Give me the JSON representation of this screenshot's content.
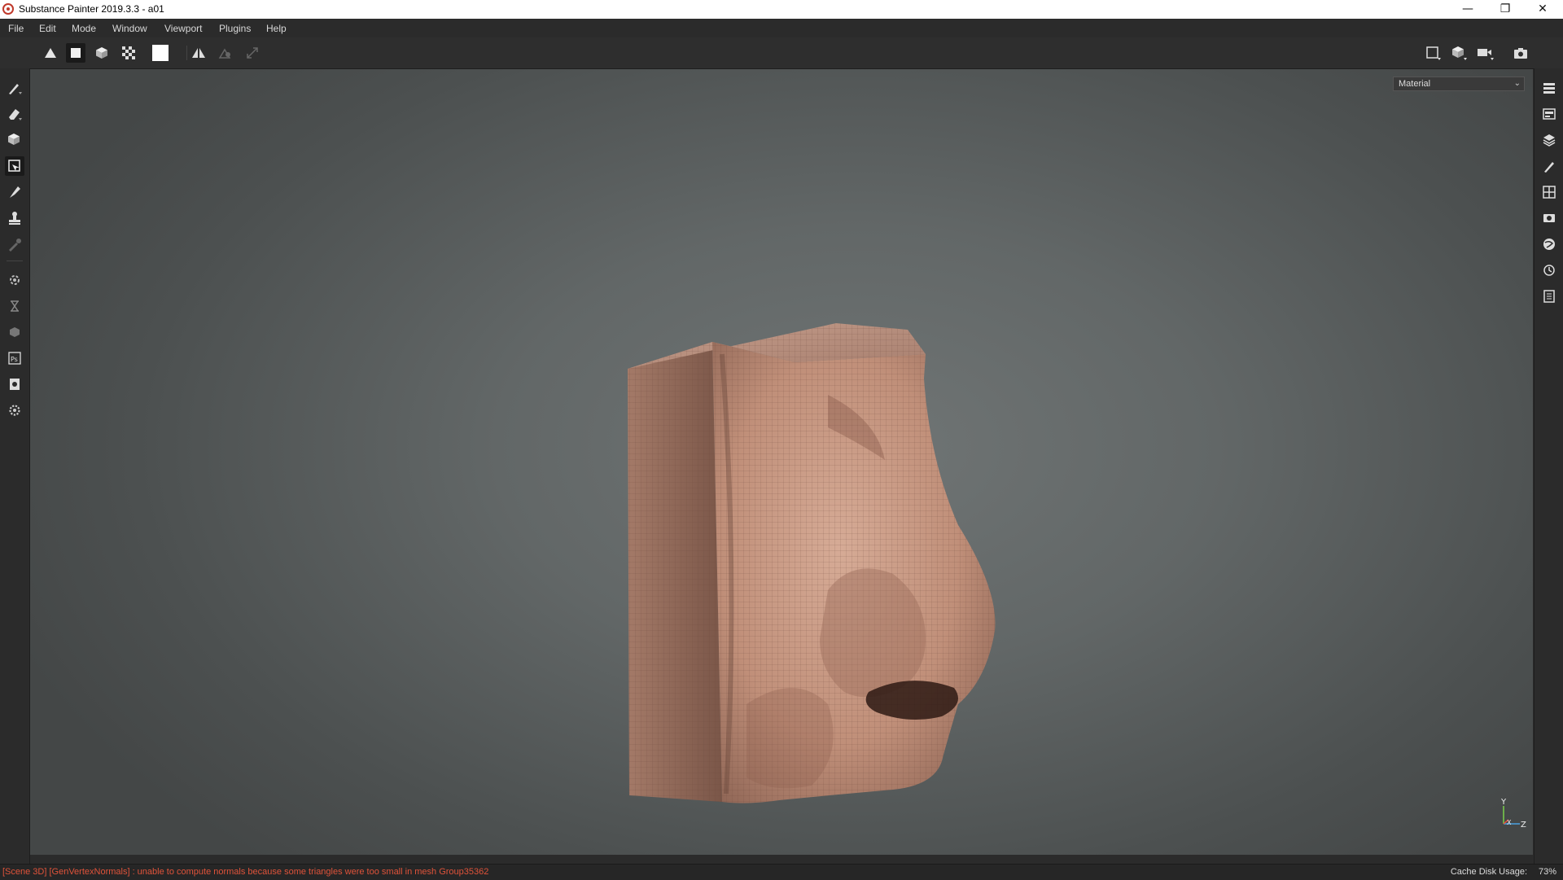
{
  "window": {
    "title": "Substance Painter 2019.3.3 - a01",
    "controls": [
      "minimize",
      "restore",
      "close"
    ]
  },
  "menu": {
    "items": [
      {
        "label": "File"
      },
      {
        "label": "Edit"
      },
      {
        "label": "Mode"
      },
      {
        "label": "Window"
      },
      {
        "label": "Viewport"
      },
      {
        "label": "Plugins"
      },
      {
        "label": "Help"
      }
    ]
  },
  "toolbar": {
    "left_icons": [
      "triangle-mode-icon",
      "square-mode-icon",
      "cube-mode-icon",
      "checker-mode-icon",
      "white-swatch-icon",
      "symmetry-icon",
      "stencil-icon",
      "transform-icon"
    ],
    "right_icons": [
      "camera-2d-icon",
      "camera-3d-icon",
      "camera-video-icon",
      "screenshot-icon"
    ]
  },
  "left_tools": [
    "paint-brush-icon",
    "eraser-icon",
    "projection-icon",
    "polygon-fill-icon",
    "smudge-icon",
    "clone-stamp-icon",
    "color-picker-icon",
    "bake-icon",
    "iray-icon",
    "sphere-icon",
    "photoshop-icon",
    "export-icon",
    "settings-icon"
  ],
  "right_panel_icons": [
    "layers-stack-icon",
    "texture-set-icon",
    "layers-icon",
    "brush-properties-icon",
    "display-settings-icon",
    "viewer-settings-icon",
    "environment-icon",
    "history-icon",
    "log-icon"
  ],
  "viewport": {
    "display_mode": "Material",
    "axis": {
      "y": "Y",
      "x": "X",
      "z": "Z"
    }
  },
  "status": {
    "message": "[Scene 3D] [GenVertexNormals] : unable to compute normals because some triangles were too small in mesh Group35362",
    "cache_label": "Cache Disk Usage:",
    "cache_value": "73%"
  },
  "colors": {
    "error_text": "#e0533a",
    "skin": "#c89a84"
  }
}
